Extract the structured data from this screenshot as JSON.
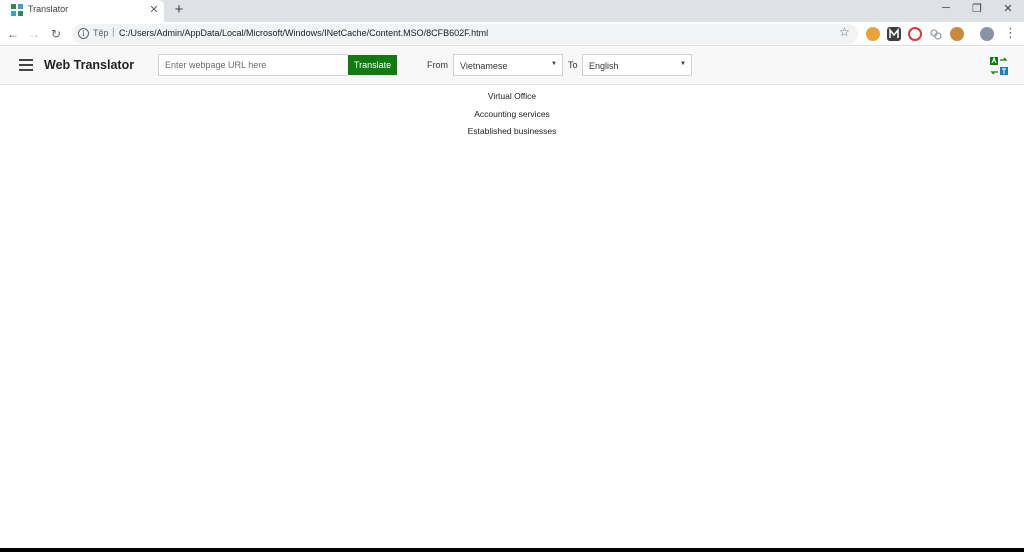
{
  "browser": {
    "tab": {
      "title": "Translator",
      "close": "✕"
    },
    "new_tab": "+",
    "window": {
      "minimize": "─",
      "restore": "❐",
      "close": "✕"
    },
    "nav": {
      "back": "←",
      "forward": "→",
      "reload": "↻"
    },
    "address": {
      "info": "i",
      "scheme_label": "Tệp",
      "separator": "|",
      "url": "C:/Users/Admin/AppData/Local/Microsoft/Windows/INetCache/Content.MSO/8CFB602F.html"
    },
    "bookmark_star": "☆",
    "extensions": [
      "extension-icon",
      "m-extension-icon",
      "readwise-extension-icon",
      "link-extension-icon",
      "cookie-extension-icon"
    ],
    "menu": "⋮"
  },
  "app": {
    "brand": "Web Translator",
    "url_input": {
      "placeholder": "Enter webpage URL here",
      "value": ""
    },
    "translate_button": "Translate",
    "from_label": "From",
    "from_value": "Vietnamese",
    "to_label": "To",
    "to_value": "English",
    "colors": {
      "accent": "#107c10",
      "header_bg": "#f8f8f8"
    }
  },
  "content": {
    "lines": [
      "Virtual Office",
      "Accounting services",
      "Established businesses"
    ]
  }
}
